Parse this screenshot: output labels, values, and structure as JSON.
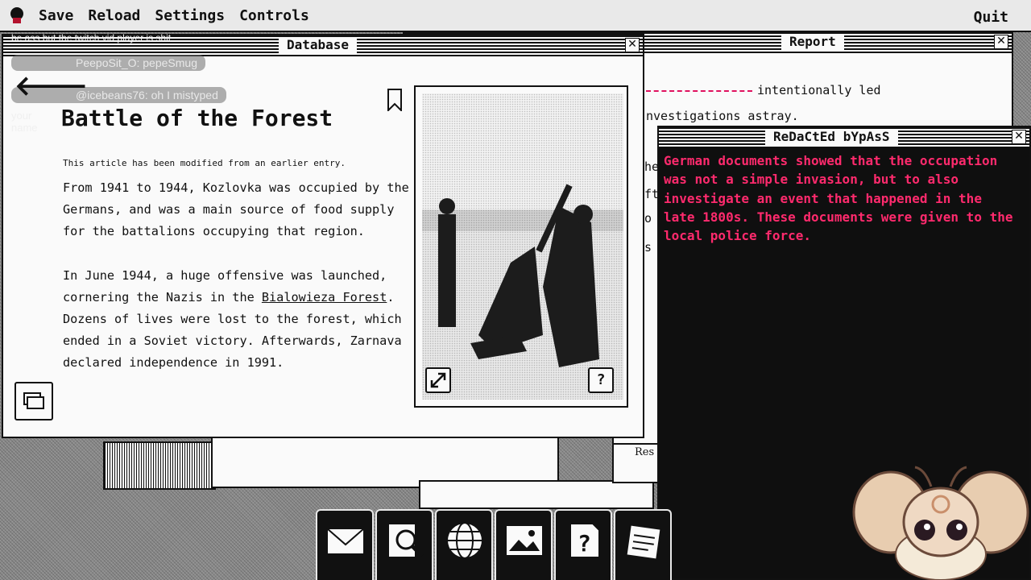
{
  "menubar": {
    "items": [
      "Save",
      "Reload",
      "Settings",
      "Controls"
    ],
    "quit": "Quit"
  },
  "chat": {
    "line0": "be ass but the twitch vid player is shit",
    "line1": "PeepoSit_O: pepeSmug",
    "line2": "@icebeans76: oh I mistyped",
    "line2b": "your name"
  },
  "report": {
    "title": "Report",
    "line1": "intentionally led",
    "line2": "nvestigations astray.",
    "frag1": "he",
    "frag2": "ft",
    "frag3": "o",
    "frag4": "s"
  },
  "redacted": {
    "title": "ReDaCtEd bYpAsS",
    "text": "German documents showed that the occupation was not a simple invasion, but to also investigate an event that happened in the late 1800s. These documents were given to the local police force."
  },
  "database": {
    "title": "Database",
    "article_title": "Battle of the Forest",
    "modified_note": "This article has been modified from an earlier entry.",
    "para1": "From 1941 to 1944, Kozlovka was occupied by the Germans, and was a main source of food supply for the battalions occupying that region.",
    "para2_pre": "In June 1944, a huge offensive was launched, cornering the Nazis in the ",
    "para2_link": "Bialowieza Forest",
    "para2_post": ". Dozens of lives were lost to the forest, which ended in a Soviet victory. Afterwards, Zarnava declared independence in 1991.",
    "help_label": "?"
  },
  "background": {
    "res_label": "Res"
  },
  "dock": {
    "items": [
      "mail-icon",
      "search-doc-icon",
      "globe-icon",
      "image-icon",
      "help-doc-icon",
      "notes-icon"
    ]
  }
}
